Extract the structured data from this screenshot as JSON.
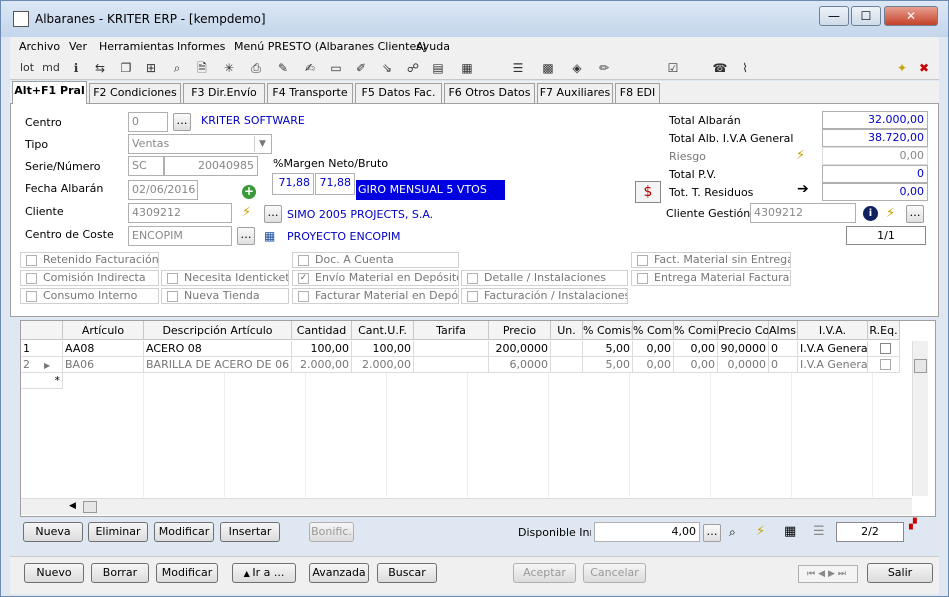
{
  "window": {
    "title": "Albaranes - KRITER ERP -  [kempdemo]"
  },
  "menu": [
    "Archivo",
    "Ver",
    "Herramientas",
    "Informes",
    "Menú PRESTO (Albaranes Clientes)",
    "Ayuda"
  ],
  "toolbar": {
    "lot_label": "lot",
    "md_label": "md"
  },
  "tabs": [
    "Alt+F1 Pral",
    "F2 Condiciones",
    "F3 Dir.Envío",
    "F4 Transporte",
    "F5 Datos Fac.",
    "F6 Otros Datos",
    "F7 Auxiliares",
    "F8 EDI"
  ],
  "form": {
    "centro_label": "Centro",
    "centro_value": "0",
    "centro_name": "KRITER SOFTWARE",
    "tipo_label": "Tipo",
    "tipo_value": "Ventas",
    "serie_label": "Serie/Número",
    "serie_value": "SC",
    "numero_value": "20040985",
    "fecha_label": "Fecha Albarán",
    "fecha_value": "02/06/2016",
    "cliente_label": "Cliente",
    "cliente_value": "4309212",
    "cliente_name": "SIMO 2005 PROJECTS, S.A.",
    "coste_label": "Centro de Coste",
    "coste_value": "ENCOPIM",
    "coste_name": "PROYECTO ENCOPIM",
    "margen_label": "%Margen Neto/Bruto",
    "margen_neto": "71,88",
    "margen_bruto": "71,88",
    "giro": "GIRO MENSUAL 5 VTOS"
  },
  "totals": {
    "total_albaran_label": "Total Albarán",
    "total_albaran": "32.000,00",
    "total_iva_label": "Total Alb. I.V.A General",
    "total_iva": "38.720,00",
    "riesgo_label": "Riesgo",
    "riesgo": "0,00",
    "total_pv_label": "Total P.V.",
    "total_pv": "0",
    "residuos_label": "Tot. T. Residuos",
    "residuos": "0,00",
    "gestion_label": "Cliente Gestión",
    "gestion_value": "4309212",
    "pager": "1/1"
  },
  "checkboxes": {
    "retenido": "Retenido Facturación",
    "comision": "Comisión Indirecta",
    "consumo": "Consumo Interno",
    "identicket": "Necesita Identicket/A",
    "nueva_tienda": "Nueva Tienda",
    "doc_cuenta": "Doc. A Cuenta",
    "envio": "Envío Material en Depósito",
    "facturar": "Facturar Material en Depósito",
    "detalle": "Detalle / Instalaciones",
    "facturacion": "Facturación / Instalaciones",
    "fact_material": "Fact. Material sin Entrega",
    "entrega": "Entrega Material Facturado"
  },
  "grid": {
    "headers": [
      "Artículo",
      "Descripción Artículo",
      "Cantidad",
      "Cant.U.F.",
      "Tarifa",
      "Precio",
      "Un.",
      "% Comisió",
      "% Comis.",
      "% Comis.",
      "Precio Cost",
      "Alms.",
      "I.V.A.",
      "R.Eq."
    ],
    "rows": [
      {
        "num": "1",
        "articulo": "AA08",
        "descripcion": "ACERO 08",
        "cantidad": "100,00",
        "cantuf": "100,00",
        "tarifa": "",
        "precio": "200,0000",
        "un": "",
        "com1": "5,00",
        "com2": "0,00",
        "com3": "0,00",
        "coste": "90,0000",
        "alms": "0",
        "iva": "I.V.A General"
      },
      {
        "num": "2",
        "articulo": "BA06",
        "descripcion": "BARILLA DE ACERO DE 06",
        "cantidad": "2.000,00",
        "cantuf": "2.000,00",
        "tarifa": "",
        "precio": "6,0000",
        "un": "",
        "com1": "5,00",
        "com2": "0,00",
        "com3": "0,00",
        "coste": "0,0000",
        "alms": "0",
        "iva": "I.V.A General"
      }
    ],
    "new_row_marker": "*"
  },
  "grid_buttons": {
    "nueva": "Nueva",
    "eliminar": "Eliminar",
    "modificar": "Modificar",
    "insertar": "Insertar",
    "bonific": "Bonific."
  },
  "disponible": {
    "label": "Disponible Inme",
    "value": "4,00",
    "pager": "2/2"
  },
  "bottom_buttons": {
    "nuevo": "Nuevo",
    "borrar": "Borrar",
    "modificar": "Modificar",
    "ir_a": "Ir a ...",
    "avanzada": "Avanzada",
    "buscar": "Buscar",
    "aceptar": "Aceptar",
    "cancelar": "Cancelar",
    "salir": "Salir"
  }
}
